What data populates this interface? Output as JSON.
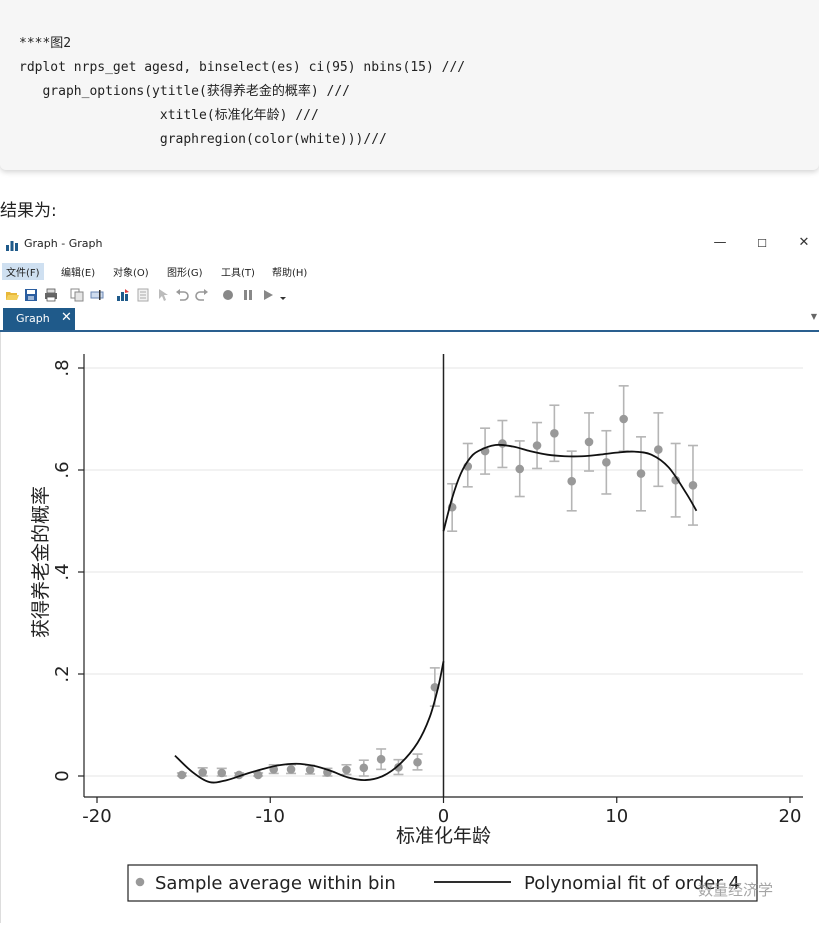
{
  "code": {
    "lines": [
      "****图2",
      "rdplot nrps_get agesd, binselect(es) ci(95) nbins(15) ///",
      "   graph_options(ytitle(获得养老金的概率) ///",
      "                  xtitle(标准化年龄) ///",
      "                  graphregion(color(white)))///"
    ]
  },
  "result_label": "结果为:",
  "window": {
    "title": "Graph - Graph",
    "controls": {
      "minimize": "—",
      "maximize": "☐",
      "close": "✕"
    },
    "menu": [
      "文件(F)",
      "编辑(E)",
      "对象(O)",
      "图形(G)",
      "工具(T)",
      "帮助(H)"
    ],
    "tab": {
      "label": "Graph",
      "close": "✕"
    },
    "icons": [
      "open-icon",
      "save-icon",
      "print-icon",
      "copy-icon",
      "rename-icon",
      "graph-editor-icon",
      "viewer-icon",
      "pointer-icon",
      "undo-icon",
      "redo-icon",
      "record-icon",
      "pause-icon",
      "play-icon",
      "dropdown-icon"
    ]
  },
  "chart_data": {
    "type": "scatter",
    "xlabel": "标准化年龄",
    "ylabel": "获得养老金的概率",
    "xlim": [
      -21,
      21
    ],
    "ylim": [
      -0.04,
      0.82
    ],
    "xticks": [
      -20,
      -10,
      0,
      10,
      20
    ],
    "xtick_labels": [
      "-20",
      "-10",
      "0",
      "10",
      "20"
    ],
    "yticks": [
      0,
      0.2,
      0.4,
      0.6,
      0.8
    ],
    "ytick_labels": [
      "0",
      ".2",
      ".4",
      ".6",
      ".8"
    ],
    "grid": true,
    "cutoff": 0,
    "legend": {
      "position": "bottom",
      "items": [
        "Sample average within bin",
        "Polynomial fit of order 4"
      ]
    },
    "series": [
      {
        "name": "Sample average within bin",
        "marker": "circle",
        "color": "#999999",
        "x": [
          -15.1,
          -13.9,
          -12.8,
          -11.8,
          -10.7,
          -9.8,
          -8.8,
          -7.7,
          -6.7,
          -5.6,
          -4.6,
          -3.6,
          -2.6,
          -1.5,
          -0.5,
          0.5,
          1.4,
          2.4,
          3.4,
          4.4,
          5.4,
          6.4,
          7.4,
          8.4,
          9.4,
          10.4,
          11.4,
          12.4,
          13.4,
          14.4
        ],
        "y": [
          0.002,
          0.007,
          0.006,
          0.002,
          0.002,
          0.013,
          0.013,
          0.012,
          0.007,
          0.012,
          0.016,
          0.033,
          0.017,
          0.027,
          0.174,
          0.527,
          0.607,
          0.637,
          0.652,
          0.602,
          0.648,
          0.672,
          0.578,
          0.655,
          0.615,
          0.7,
          0.593,
          0.64,
          0.58,
          0.57
        ],
        "ci_low": [
          0.0,
          0.0,
          0.0,
          0.0,
          0.0,
          0.005,
          0.005,
          0.004,
          0.0,
          0.003,
          0.0,
          0.013,
          0.003,
          0.012,
          0.137,
          0.48,
          0.567,
          0.592,
          0.605,
          0.548,
          0.603,
          0.617,
          0.52,
          0.598,
          0.553,
          0.637,
          0.52,
          0.568,
          0.508,
          0.492
        ],
        "ci_high": [
          0.006,
          0.016,
          0.015,
          0.006,
          0.006,
          0.022,
          0.022,
          0.021,
          0.015,
          0.022,
          0.031,
          0.053,
          0.032,
          0.043,
          0.212,
          0.573,
          0.652,
          0.682,
          0.697,
          0.657,
          0.693,
          0.727,
          0.637,
          0.712,
          0.677,
          0.765,
          0.665,
          0.712,
          0.652,
          0.648
        ]
      },
      {
        "name": "Polynomial fit of order 4",
        "color": "#111111",
        "segments": [
          {
            "x": [
              -15.5,
              -14.5,
              -13.5,
              -12.5,
              -11.5,
              -10.5,
              -9.5,
              -8.5,
              -7.5,
              -6.5,
              -5.5,
              -4.5,
              -3.5,
              -2.5,
              -1.5,
              -0.8,
              -0.3,
              0.0
            ],
            "y": [
              0.04,
              0.008,
              -0.012,
              -0.008,
              0.003,
              0.013,
              0.021,
              0.024,
              0.02,
              0.01,
              -0.003,
              -0.008,
              0.0,
              0.024,
              0.065,
              0.115,
              0.175,
              0.225
            ]
          },
          {
            "x": [
              0.0,
              0.5,
              1.0,
              1.5,
              2.0,
              3.0,
              4.0,
              5.0,
              6.0,
              7.0,
              8.0,
              9.0,
              10.0,
              11.0,
              12.0,
              13.0,
              14.0,
              14.6
            ],
            "y": [
              0.48,
              0.545,
              0.593,
              0.622,
              0.637,
              0.649,
              0.646,
              0.637,
              0.63,
              0.627,
              0.627,
              0.63,
              0.634,
              0.636,
              0.63,
              0.605,
              0.555,
              0.52
            ]
          }
        ]
      }
    ]
  },
  "watermark": "数量经济学"
}
